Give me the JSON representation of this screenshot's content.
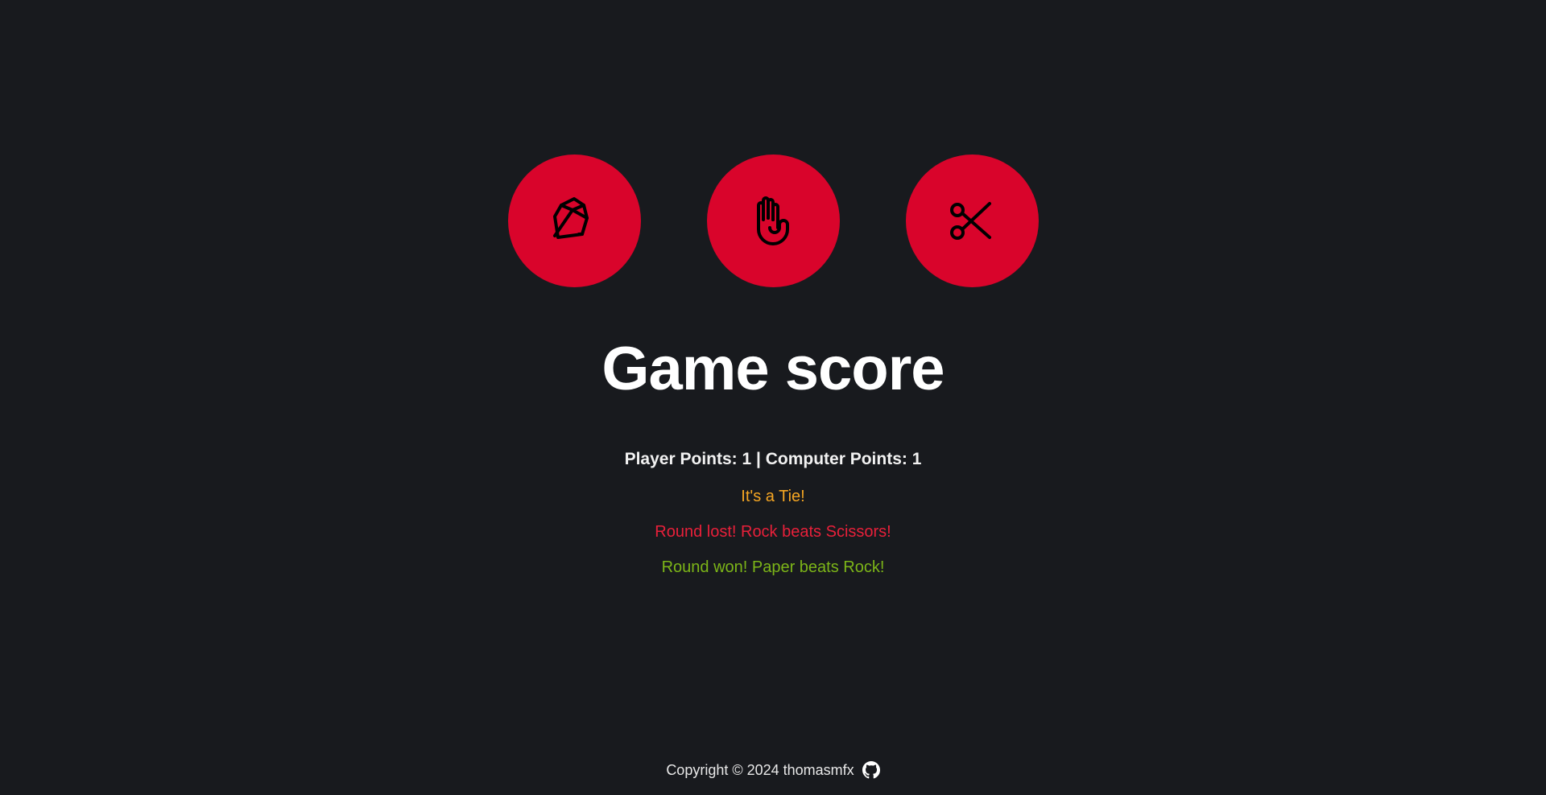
{
  "choices": [
    {
      "label": "Rock",
      "icon": "rock-icon"
    },
    {
      "label": "Paper",
      "icon": "hand-icon"
    },
    {
      "label": "Scissors",
      "icon": "scissors-icon"
    }
  ],
  "colors": {
    "background": "#181a1e",
    "button": "#d9042b",
    "tie": "#f5a623",
    "lost": "#e8203a",
    "won": "#7cb518"
  },
  "title": "Game score",
  "score": "Player Points: 1 | Computer Points: 1",
  "log": {
    "tie": "It's a Tie!",
    "lost": "Round lost! Rock beats Scissors!",
    "won": "Round won! Paper beats Rock!"
  },
  "footer": {
    "copyright": "Copyright © 2024 thomasmfx",
    "github_icon": "github-icon"
  }
}
